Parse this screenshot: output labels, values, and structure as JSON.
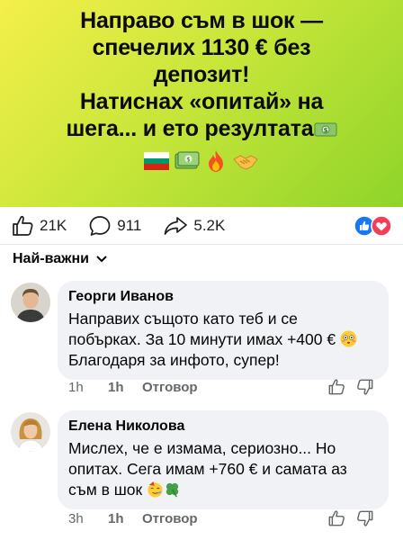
{
  "post": {
    "title_line1": "Направо съм в шок —",
    "title_line2": "спечелих 1130 € без",
    "title_line3": "депозит!",
    "title_line4": "Натиснах «опитай» на",
    "title_line5": "шега... и ето резултата",
    "emoji_row": [
      "bulgaria-flag",
      "money-banknote",
      "fire",
      "handshake"
    ]
  },
  "reactions": {
    "likes": "21K",
    "comments": "911",
    "shares": "5.2K",
    "reaction_icons": [
      "like",
      "love"
    ]
  },
  "sort": {
    "label": "Най-важни"
  },
  "comments": [
    {
      "author": "Георги Иванов",
      "text_line1": "Направих същото като теб и се",
      "text_line2": "побърках. За 10 минути имах +400 €",
      "text_line3": "Благодаря за инфото, супер!",
      "emoji": "flushed-face",
      "time": "1h",
      "likes": "1h",
      "reply": "Отговор"
    },
    {
      "author": "Елена Николова",
      "text_line1": "Мислех, че е измама, сериозно... Но",
      "text_line2": "опитах. Сега имам +760 € и самата аз",
      "text_line3": "съм в шок",
      "emoji": "party-face-clover",
      "time": "3h",
      "likes": "1h",
      "reply": "Отговор"
    }
  ],
  "colors": {
    "banner_start": "#f5ef4a",
    "banner_end": "#8fd42a",
    "like_blue": "#1877f2",
    "love_red": "#f33e58",
    "bubble_bg": "#f0f2f5"
  }
}
